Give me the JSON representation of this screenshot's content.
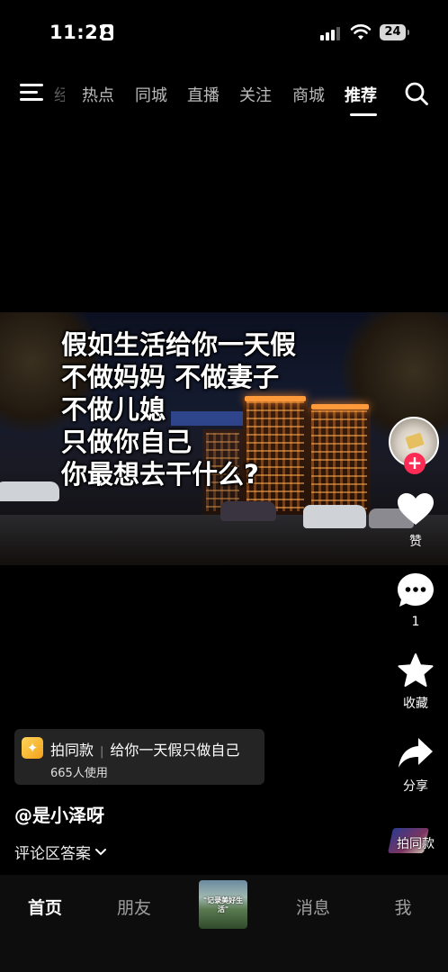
{
  "status_bar": {
    "time": "11:22",
    "battery": "24"
  },
  "top_nav": {
    "partial_tab": "经",
    "tabs": [
      {
        "label": "热点"
      },
      {
        "label": "同城"
      },
      {
        "label": "直播"
      },
      {
        "label": "关注"
      },
      {
        "label": "商城"
      },
      {
        "label": "推荐",
        "active": true
      }
    ]
  },
  "video": {
    "caption_lines": [
      "假如生活给你一天假",
      "不做妈妈 不做妻子",
      "不做儿媳",
      "只做你自己",
      "你最想去干什么?"
    ]
  },
  "actions": {
    "follow": "+",
    "like_label": "赞",
    "comment_count": "1",
    "favorite_label": "收藏",
    "share_label": "分享",
    "remix_label": "拍同款"
  },
  "template_card": {
    "title": "拍同款",
    "name": "给你一天假只做自己",
    "users": "665人使用"
  },
  "author": "@是小泽呀",
  "comment_answer": "评论区答案",
  "bottom_nav": {
    "home": "首页",
    "friends": "朋友",
    "messages": "消息",
    "me": "我",
    "create_thumb_text": "\"记录美好生活\""
  },
  "colors": {
    "accent": "#fe2c55",
    "background": "#000000",
    "template_icon": "#f2a21a"
  }
}
